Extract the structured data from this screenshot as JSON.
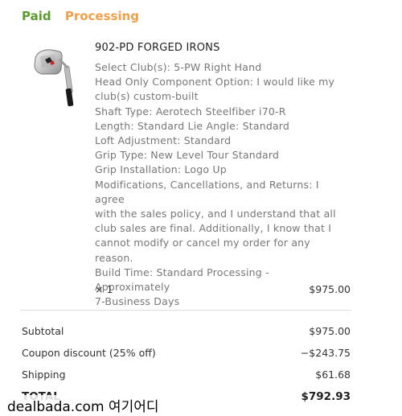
{
  "order_status": {
    "paid": "Paid",
    "processing": "Processing"
  },
  "item": {
    "title": "902-PD FORGED IRONS",
    "meta": [
      "Select Club(s): 5-PW Right Hand",
      "Head Only Component Option: I would like my",
      "club(s) custom-built",
      "Shaft Type: Aerotech Steelfiber i70-R",
      "Length: Standard Lie Angle: Standard",
      "Loft Adjustment: Standard",
      "Grip Type: New Level Tour Standard",
      "Grip Installation: Logo Up",
      "Modifications, Cancellations, and Returns: I agree",
      "with the sales policy, and I understand that all",
      "club sales are final. Additionally, I know that I",
      "cannot modify or cancel my order for any",
      "reason.",
      "Build Time: Standard Processing - Approximately",
      "7-Business Days"
    ],
    "quantity": "× 1",
    "price": "$975.00"
  },
  "summary": {
    "subtotal_label": "Subtotal",
    "subtotal_value": "$975.00",
    "coupon_label": "Coupon discount (25% off)",
    "coupon_value": "−$243.75",
    "shipping_label": "Shipping",
    "shipping_value": "$61.68",
    "total_label": "TOTAL",
    "total_value": "$792.93"
  },
  "watermark": "dealbada.com 여기어디"
}
